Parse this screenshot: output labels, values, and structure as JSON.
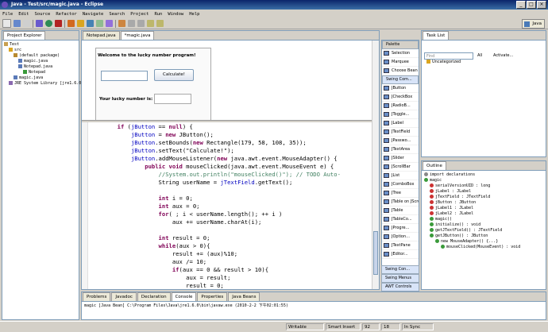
{
  "window": {
    "title": "Java - Test/src/magic.java - Eclipse",
    "buttons": [
      "_",
      "□",
      "×"
    ]
  },
  "menu": [
    "File",
    "Edit",
    "Source",
    "Refactor",
    "Navigate",
    "Search",
    "Project",
    "Run",
    "Window",
    "Help"
  ],
  "perspective": {
    "label": "Java"
  },
  "explorer": {
    "tab": "Project Explorer",
    "tree": [
      {
        "label": "Test",
        "depth": 0,
        "icon": "project-icon"
      },
      {
        "label": "src",
        "depth": 1,
        "icon": "folder-icon"
      },
      {
        "label": "(default package)",
        "depth": 2,
        "icon": "package-icon"
      },
      {
        "label": "magic.java",
        "depth": 3,
        "icon": "java-file-icon"
      },
      {
        "label": "Notepad.java",
        "depth": 3,
        "icon": "java-file-icon"
      },
      {
        "label": "Notepad",
        "depth": 4,
        "icon": "class-icon"
      },
      {
        "label": "magic.java",
        "depth": 2,
        "icon": "java-file-icon"
      },
      {
        "label": "JRE System Library [jre1.6.0]",
        "depth": 1,
        "icon": "library-icon"
      }
    ]
  },
  "editor": {
    "tabs": [
      {
        "label": "Notepad.java",
        "active": false
      },
      {
        "label": "*magic.java",
        "active": true
      }
    ],
    "design": {
      "welcome": "Welcome to the lucky number program!",
      "input_value": "",
      "calc_button": "Calculate!",
      "result_label": "Your lucky number is:",
      "result_value": ""
    },
    "code_lines": [
      [
        {
          "t": "        "
        },
        {
          "t": "if",
          "c": "kw"
        },
        {
          "t": " ("
        },
        {
          "t": "jButton",
          "c": "fd"
        },
        {
          "t": " == "
        },
        {
          "t": "null",
          "c": "kw"
        },
        {
          "t": ") {"
        }
      ],
      [
        {
          "t": "            "
        },
        {
          "t": "jButton",
          "c": "fd"
        },
        {
          "t": " = "
        },
        {
          "t": "new",
          "c": "kw"
        },
        {
          "t": " JButton();"
        }
      ],
      [
        {
          "t": "            "
        },
        {
          "t": "jButton",
          "c": "fd"
        },
        {
          "t": ".setBounds("
        },
        {
          "t": "new",
          "c": "kw"
        },
        {
          "t": " Rectangle(179, 58, 108, 35));"
        }
      ],
      [
        {
          "t": "            "
        },
        {
          "t": "jButton",
          "c": "fd"
        },
        {
          "t": ".setText(\"Calculate!\");"
        }
      ],
      [
        {
          "t": "            "
        },
        {
          "t": "jButton",
          "c": "fd"
        },
        {
          "t": ".addMouseListener("
        },
        {
          "t": "new",
          "c": "kw"
        },
        {
          "t": " java.awt.event.MouseAdapter() {"
        }
      ],
      [
        {
          "t": "                "
        },
        {
          "t": "public void",
          "c": "kw"
        },
        {
          "t": " mouseClicked(java.awt.event.MouseEvent e) {"
        }
      ],
      [
        {
          "t": "                    "
        },
        {
          "t": "//System.out.println(\"mouseClicked()\"); // TODO Auto-",
          "c": "cm"
        }
      ],
      [
        {
          "t": "                    String userName = "
        },
        {
          "t": "jTextField",
          "c": "fd"
        },
        {
          "t": ".getText();"
        }
      ],
      [
        {
          "t": ""
        }
      ],
      [
        {
          "t": "                    "
        },
        {
          "t": "int",
          "c": "kw"
        },
        {
          "t": " i = 0;"
        }
      ],
      [
        {
          "t": "                    "
        },
        {
          "t": "int",
          "c": "kw"
        },
        {
          "t": " aux = 0;"
        }
      ],
      [
        {
          "t": "                    "
        },
        {
          "t": "for",
          "c": "kw"
        },
        {
          "t": "( ; i < userName.length(); ++ i )"
        }
      ],
      [
        {
          "t": "                        aux += userName.charAt(i);"
        }
      ],
      [
        {
          "t": ""
        }
      ],
      [
        {
          "t": "                    "
        },
        {
          "t": "int",
          "c": "kw"
        },
        {
          "t": " result = 0;"
        }
      ],
      [
        {
          "t": "                    "
        },
        {
          "t": "while",
          "c": "kw"
        },
        {
          "t": "(aux > 0){"
        }
      ],
      [
        {
          "t": "                        result += (aux)%10;"
        }
      ],
      [
        {
          "t": "                        aux /= 10;"
        }
      ],
      [
        {
          "t": "                        "
        },
        {
          "t": "if",
          "c": "kw"
        },
        {
          "t": "(aux == 0 && result > 10){"
        }
      ],
      [
        {
          "t": "                            aux = result;"
        }
      ],
      [
        {
          "t": "                            result = 0;"
        }
      ],
      [
        {
          "t": "                        }"
        }
      ],
      [
        {
          "t": "                    }"
        }
      ]
    ]
  },
  "palette": {
    "title": "Palette",
    "top_items": [
      "Selection",
      "Marquee",
      "Choose Bean"
    ],
    "group": "Swing Com...",
    "items": [
      "JButton",
      "JCheckBox",
      "JRadioB...",
      "JToggle...",
      "JLabel",
      "JTextField",
      "JPasswo...",
      "JTextArea",
      "JSlider",
      "JScrollBar",
      "JList",
      "JComboBox",
      "JTree",
      "JTable on JScroll...",
      "JTable",
      "JTableCo...",
      "JProgre...",
      "JOption...",
      "JTextPane",
      "JEditor..."
    ],
    "footer": [
      "Swing Con...",
      "Swing Menus",
      "AWT Controls"
    ]
  },
  "tasklist": {
    "tab": "Task List",
    "find_placeholder": "Find",
    "filters": [
      "All",
      "Activate..."
    ],
    "category": "Uncategorized"
  },
  "outline": {
    "tab": "Outline",
    "items": [
      {
        "label": "import declarations",
        "depth": 0
      },
      {
        "label": "magic",
        "depth": 0
      },
      {
        "label": "serialVersionUID : long",
        "depth": 1
      },
      {
        "label": "jLabel : JLabel",
        "depth": 1
      },
      {
        "label": "jTextField : JTextField",
        "depth": 1
      },
      {
        "label": "jButton : JButton",
        "depth": 1
      },
      {
        "label": "jLabel1 : JLabel",
        "depth": 1
      },
      {
        "label": "jLabel2 : JLabel",
        "depth": 1
      },
      {
        "label": "magic()",
        "depth": 1
      },
      {
        "label": "initialize() : void",
        "depth": 1
      },
      {
        "label": "getJTextField() : JTextField",
        "depth": 1
      },
      {
        "label": "getJButton() : JButton",
        "depth": 1
      },
      {
        "label": "new MouseAdapter() {...}",
        "depth": 2
      },
      {
        "label": "mouseClicked(MouseEvent) : void",
        "depth": 3
      }
    ]
  },
  "console": {
    "tabs": [
      "Problems",
      "Javadoc",
      "Declaration",
      "Console",
      "Properties",
      "Java Beans"
    ],
    "active": "Console",
    "line": "magic [Java Bean] C:\\Program Files\\Java\\jre1.6.0\\bin\\javaw.exe (2010-2-2 下午02:01:55)"
  },
  "status": {
    "writable": "Writable",
    "insert": "Smart Insert",
    "line": "92",
    "col": "18",
    "sync": "In Sync"
  },
  "colors": {
    "accent": "#0a246a",
    "keyword": "#7f0055",
    "comment": "#3f7f5f",
    "field": "#0000c0"
  }
}
